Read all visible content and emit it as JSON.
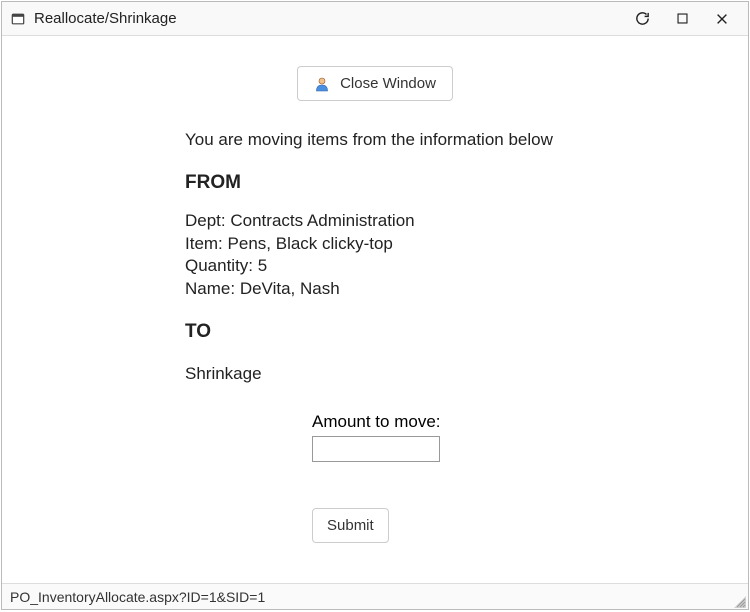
{
  "window": {
    "title": "Reallocate/Shrinkage"
  },
  "actions": {
    "close_window_label": "Close Window",
    "submit_label": "Submit"
  },
  "intro": "You are moving items from the information below",
  "from": {
    "heading": "FROM",
    "dept_label": "Dept:",
    "dept_value": "Contracts Administration",
    "item_label": "Item:",
    "item_value": "Pens, Black clicky-top",
    "quantity_label": "Quantity:",
    "quantity_value": "5",
    "name_label": "Name:",
    "name_value": "DeVita, Nash"
  },
  "to": {
    "heading": "TO",
    "target": "Shrinkage"
  },
  "amount": {
    "label": "Amount to move:",
    "value": ""
  },
  "statusbar": {
    "path": "PO_InventoryAllocate.aspx?ID=1&SID=1"
  }
}
